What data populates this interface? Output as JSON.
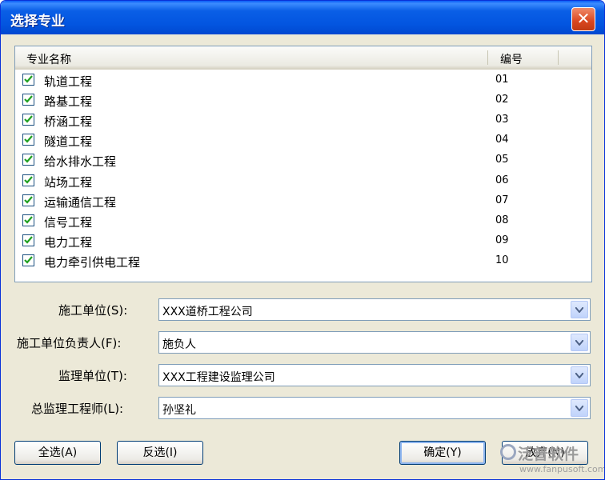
{
  "window": {
    "title": "选择专业",
    "close_label": "✕"
  },
  "list": {
    "columns": {
      "name": "专业名称",
      "code": "编号"
    },
    "rows": [
      {
        "name": "轨道工程",
        "code": "01",
        "checked": true
      },
      {
        "name": "路基工程",
        "code": "02",
        "checked": true
      },
      {
        "name": "桥涵工程",
        "code": "03",
        "checked": true
      },
      {
        "name": "隧道工程",
        "code": "04",
        "checked": true
      },
      {
        "name": "给水排水工程",
        "code": "05",
        "checked": true
      },
      {
        "name": "站场工程",
        "code": "06",
        "checked": true
      },
      {
        "name": "运输通信工程",
        "code": "07",
        "checked": true
      },
      {
        "name": "信号工程",
        "code": "08",
        "checked": true
      },
      {
        "name": "电力工程",
        "code": "09",
        "checked": true
      },
      {
        "name": "电力牵引供电工程",
        "code": "10",
        "checked": true
      }
    ]
  },
  "form": {
    "construction_unit": {
      "label": "施工单位(S):",
      "value": "XXX道桥工程公司"
    },
    "construction_manager": {
      "label": "施工单位负责人(F):",
      "value": "施负人"
    },
    "supervision_unit": {
      "label": "监理单位(T):",
      "value": "XXX工程建设监理公司"
    },
    "chief_supervisor": {
      "label": "总监理工程师(L):",
      "value": "孙坚礼"
    }
  },
  "buttons": {
    "select_all": "全选(A)",
    "invert": "反选(I)",
    "ok": "确定(Y)",
    "cancel": "放弃(N)"
  },
  "watermark": {
    "brand": "泛普软件",
    "url": "www.fanpusoft.com"
  },
  "colors": {
    "titlebar": "#0355e0",
    "close": "#d9461f",
    "check": "#21a121",
    "dialog_bg": "#ece9d8"
  }
}
